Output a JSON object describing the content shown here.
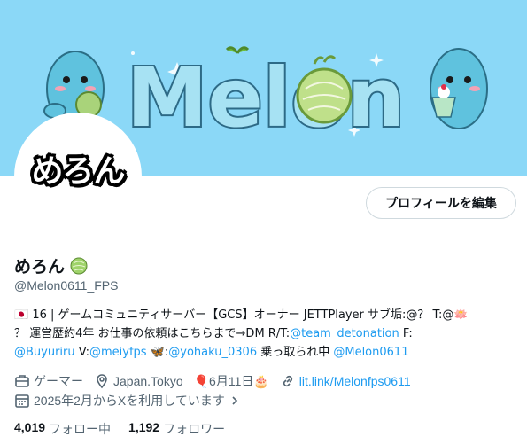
{
  "banner": {
    "logo_text": "Melon"
  },
  "avatar": {
    "text": "めろん"
  },
  "edit_profile_label": "プロフィールを編集",
  "profile": {
    "display_name": "めろん",
    "handle": "@Melon0611_FPS"
  },
  "bio": {
    "line1_a": "🇯🇵 16 | ゲームコミュニティサーバー【GCS】オーナー JETTPlayer サブ垢:@？ T:@🪷",
    "line2_a": "？ 運営歴約4年 お仕事の依頼はこちらまで→DM R/T:",
    "line2_link": "@team_detonation",
    "line2_b": " F:",
    "line3_link1": "@Buyuriru",
    "line3_a": " V:",
    "line3_link2": "@meiyfps",
    "line3_b": " 🦋:",
    "line3_link3": "@yohaku_0306",
    "line3_c": " 乗っ取られ中 ",
    "line3_link4": "@Melon0611"
  },
  "meta": {
    "category": "ゲーマー",
    "location": "Japan.Tokyo",
    "birthday": "🎈6月11日🎂",
    "website": "lit.link/Melonfps0611",
    "joined": "2025年2月からXを利用しています"
  },
  "stats": {
    "following_count": "4,019",
    "following_label": "フォロー中",
    "followers_count": "1,192",
    "followers_label": "フォロワー"
  },
  "colors": {
    "banner_bg": "#8bd8f7",
    "link": "#1d9bf0",
    "muted": "#536471"
  }
}
